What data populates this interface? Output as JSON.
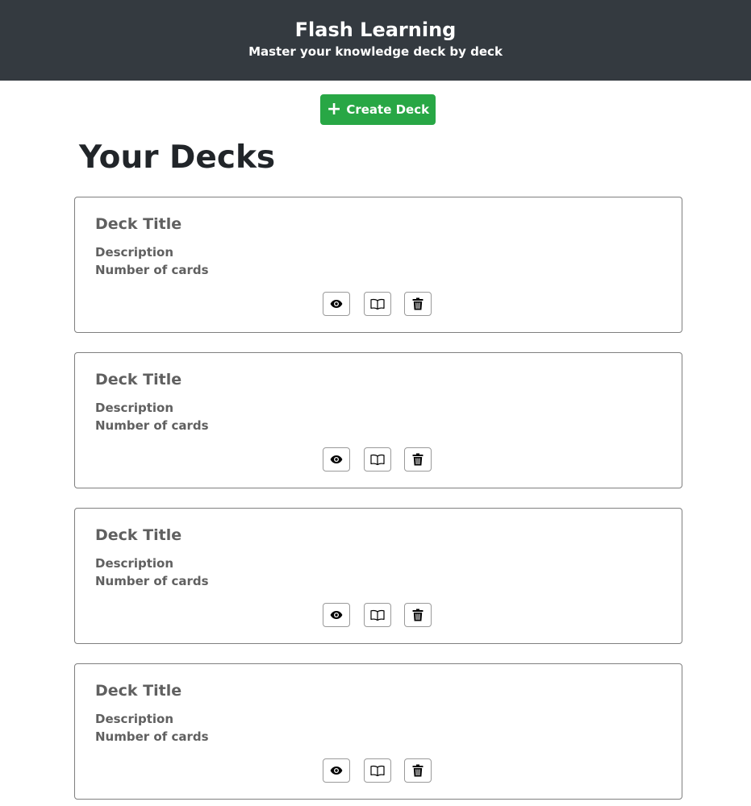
{
  "header": {
    "title": "Flash Learning",
    "subtitle": "Master your knowledge deck by deck"
  },
  "toolbar": {
    "create_label": "Create Deck",
    "create_icon": "plus-icon"
  },
  "page": {
    "title": "Your Decks"
  },
  "decks": [
    {
      "title": "Deck Title",
      "description": "Description",
      "count": "Number of cards"
    },
    {
      "title": "Deck Title",
      "description": "Description",
      "count": "Number of cards"
    },
    {
      "title": "Deck Title",
      "description": "Description",
      "count": "Number of cards"
    },
    {
      "title": "Deck Title",
      "description": "Description",
      "count": "Number of cards"
    }
  ],
  "deck_actions": {
    "view_icon": "eye-icon",
    "study_icon": "book-icon",
    "delete_icon": "trash-icon"
  },
  "colors": {
    "header_bg": "#343a40",
    "create_button": "#28a745",
    "card_text": "#606060",
    "heading": "#212529"
  }
}
